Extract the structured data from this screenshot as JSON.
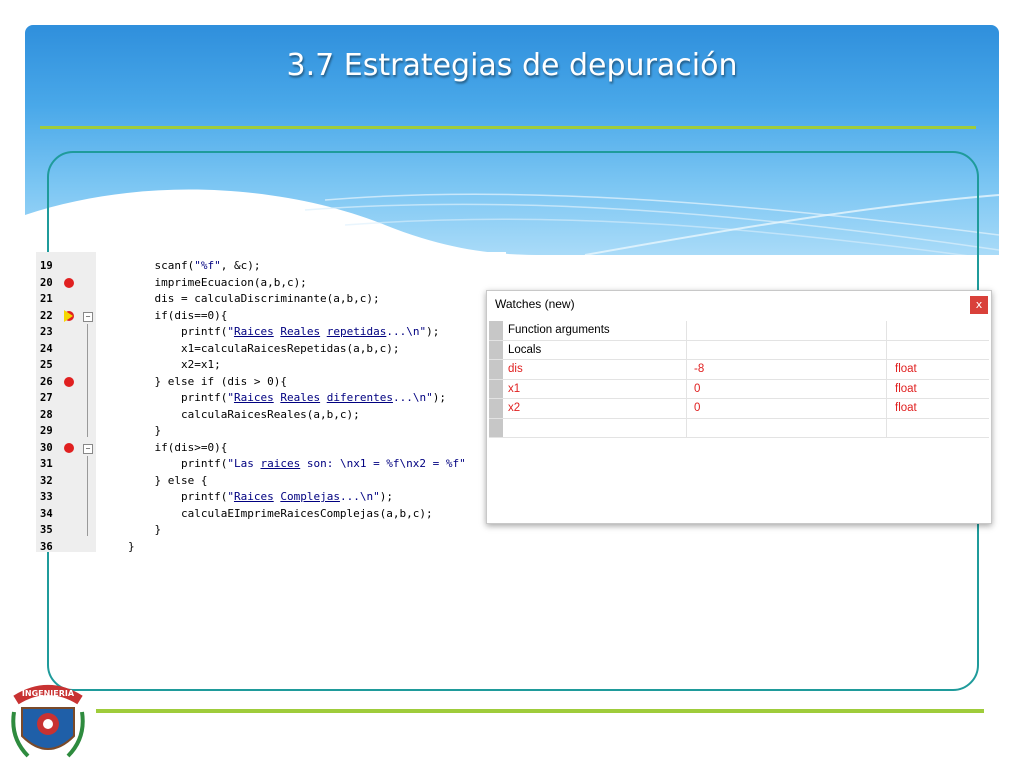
{
  "slide": {
    "title": "3.7  Estrategias de depuración",
    "logo_text": "INGENIERIA",
    "accent": "#9fcc3b",
    "frame_color": "#1f9b9b"
  },
  "editor": {
    "lines": [
      {
        "num": "19",
        "code": "    scanf(\"%f\", &c);",
        "marker": ""
      },
      {
        "num": "20",
        "code": "    imprimeEcuacion(a,b,c);",
        "marker": "breakpoint"
      },
      {
        "num": "21",
        "code": "    dis = calculaDiscriminante(a,b,c);",
        "marker": ""
      },
      {
        "num": "22",
        "code": "    if(dis==0){",
        "marker": "current"
      },
      {
        "num": "23",
        "code": "        printf(\"Raices Reales repetidas...\\n\");",
        "marker": ""
      },
      {
        "num": "24",
        "code": "        x1=calculaRaicesRepetidas(a,b,c);",
        "marker": ""
      },
      {
        "num": "25",
        "code": "        x2=x1;",
        "marker": ""
      },
      {
        "num": "26",
        "code": "    } else if (dis > 0){",
        "marker": "breakpoint"
      },
      {
        "num": "27",
        "code": "        printf(\"Raices Reales diferentes...\\n\");",
        "marker": ""
      },
      {
        "num": "28",
        "code": "        calculaRaicesReales(a,b,c);",
        "marker": ""
      },
      {
        "num": "29",
        "code": "    }",
        "marker": ""
      },
      {
        "num": "30",
        "code": "    if(dis>=0){",
        "marker": "breakpoint"
      },
      {
        "num": "31",
        "code": "        printf(\"Las raices son: \\nx1 = %f\\nx2 = %f\"",
        "marker": ""
      },
      {
        "num": "32",
        "code": "    } else {",
        "marker": ""
      },
      {
        "num": "33",
        "code": "        printf(\"Raices Complejas...\\n\");",
        "marker": ""
      },
      {
        "num": "34",
        "code": "        calculaEImprimeRaicesComplejas(a,b,c);",
        "marker": ""
      },
      {
        "num": "35",
        "code": "    }",
        "marker": ""
      },
      {
        "num": "36",
        "code": "}",
        "marker": ""
      }
    ]
  },
  "watches": {
    "title": "Watches (new)",
    "close_label": "x",
    "rows": [
      {
        "name": "Function arguments",
        "value": "",
        "type": "",
        "changed": false
      },
      {
        "name": "Locals",
        "value": "",
        "type": "",
        "changed": false
      },
      {
        "name": "dis",
        "value": "-8",
        "type": "float",
        "changed": true
      },
      {
        "name": "x1",
        "value": "0",
        "type": "float",
        "changed": true
      },
      {
        "name": "x2",
        "value": "0",
        "type": "float",
        "changed": true
      },
      {
        "name": "",
        "value": "",
        "type": "",
        "changed": false
      }
    ]
  }
}
